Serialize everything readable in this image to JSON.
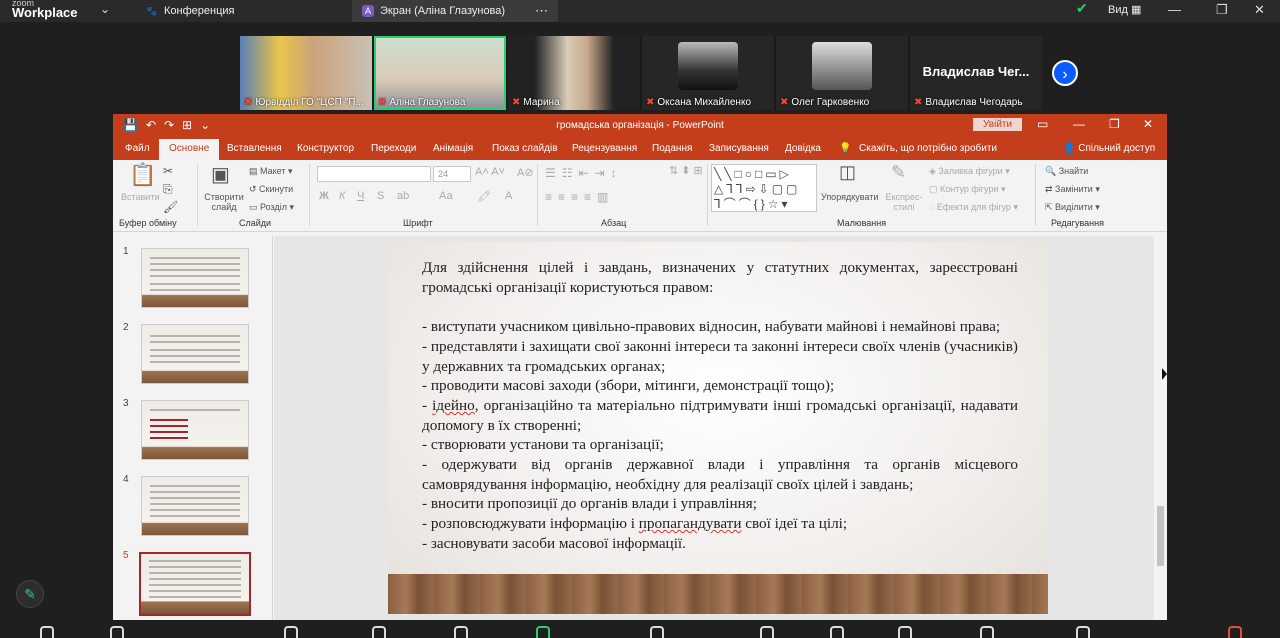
{
  "zoom": {
    "logo_small": "zoom",
    "logo_big": "Workplace",
    "tabs": [
      {
        "label": "Конференция",
        "icon": "paw-icon"
      },
      {
        "label": "Экран (Аліна Глазунова)",
        "icon_letter": "A"
      }
    ],
    "view_label": "Вид"
  },
  "participants": [
    {
      "name": "Юрвідділ ГО \"ЦСП \"П...",
      "muted": true
    },
    {
      "name": "Аліна Глазунова",
      "muted": true,
      "speaking": true
    },
    {
      "name": "Марина",
      "muted": true
    },
    {
      "name": "Оксана Михайленко",
      "muted": true
    },
    {
      "name": "Олег Гарковенко",
      "muted": true
    },
    {
      "name": "Владислав Чегодарь",
      "muted": true,
      "big_name": "Владислав Чег..."
    }
  ],
  "ppt": {
    "doc_title": "громадська організація - PowerPoint",
    "signin": "Увійти",
    "menu": [
      "Файл",
      "Основне",
      "Вставлення",
      "Конструктор",
      "Переходи",
      "Анімація",
      "Показ слайдів",
      "Рецензування",
      "Подання",
      "Записування",
      "Довідка"
    ],
    "tellme": "Скажіть, що потрібно зробити",
    "share": "Спільний доступ",
    "ribbon": {
      "paste": "Вставити",
      "clipboard": "Буфер обміну",
      "new_slide": "Створити слайд",
      "layout": "Макет",
      "reset": "Скинути",
      "section": "Розділ",
      "slides": "Слайди",
      "font_size": "24",
      "font": "Шрифт",
      "paragraph": "Абзац",
      "arrange": "Упорядкувати",
      "express": "Експрес-стилі",
      "fill": "Заливка фігури",
      "outline": "Контур фігури",
      "effects": "Ефекти для фігур",
      "drawing": "Малювання",
      "find": "Знайти",
      "replace": "Замінити",
      "select": "Виділити",
      "editing": "Редагування",
      "bold": "Ж",
      "italic": "К",
      "underline": "Ч",
      "strike": "S",
      "font_btn": "Аа"
    },
    "thumbnails": [
      "1",
      "2",
      "3",
      "4",
      "5"
    ],
    "selected_slide": 5
  },
  "slide": {
    "paragraphs": [
      "Для здійснення цілей і завдань, визначених у статутних документах, зареєстровані громадські організації користуються правом:",
      "",
      "- виступати учасником цивільно-правових відносин, набувати майнові і немайнові права;",
      "- представляти і захищати свої законні інтереси та законні інтереси своїх членів (учасників) у державних та громадських органах;",
      "- проводити масові заходи (збори, мітинги, демонстрації тощо);",
      "- ідейно, організаційно та матеріально підтримувати інші громадські організації, надавати допомогу в їх створенні;",
      "- створювати установи та організації;",
      "- одержувати від органів державної влади і управління та органів місцевого самоврядування інформацію, необхідну для реалізації своїх цілей і завдань;",
      "- вносити пропозиції до органів влади і управління;",
      "- розповсюджувати інформацію і пропагандувати свої ідеї та цілі;",
      "- засновувати засоби масової інформації."
    ]
  }
}
